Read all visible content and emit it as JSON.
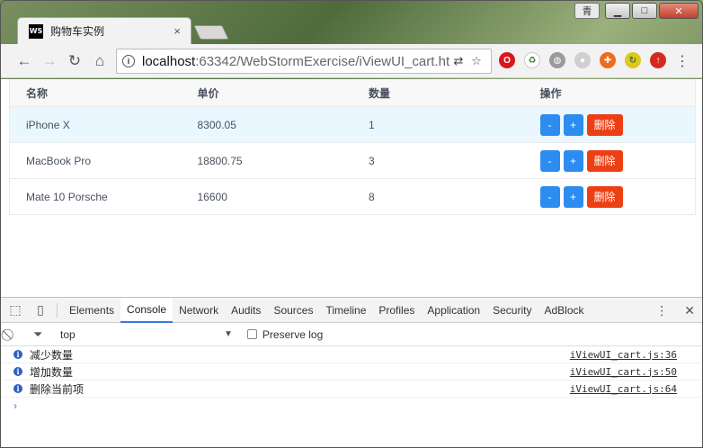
{
  "browser": {
    "tab_title": "购物车实例",
    "favicon_text": "WS",
    "tab_close": "×",
    "profile_label": "青",
    "win_minimize": "▁",
    "win_maximize": "□",
    "win_close": "✕",
    "url_host": "localhost",
    "url_path": ":63342/WebStormExercise/iViewUI_cart.ht"
  },
  "table": {
    "headers": [
      "名称",
      "单价",
      "数量",
      "操作"
    ],
    "rows": [
      {
        "name": "iPhone X",
        "price": "8300.05",
        "qty": "1"
      },
      {
        "name": "MacBook Pro",
        "price": "18800.75",
        "qty": "3"
      },
      {
        "name": "Mate 10 Porsche",
        "price": "16600",
        "qty": "8"
      }
    ],
    "btn_minus": "-",
    "btn_plus": "+",
    "btn_delete": "删除",
    "colors": {
      "primary": "#2d8cf0",
      "error": "#ed3f14",
      "highlight": "#ebf7ff"
    }
  },
  "devtools": {
    "tabs": [
      "Elements",
      "Console",
      "Network",
      "Audits",
      "Sources",
      "Timeline",
      "Profiles",
      "Application",
      "Security",
      "AdBlock"
    ],
    "active_tab": "Console",
    "context": "top",
    "preserve_log": "Preserve log",
    "logs": [
      {
        "msg": "减少数量",
        "src": "iViewUI_cart.js:36"
      },
      {
        "msg": "增加数量",
        "src": "iViewUI_cart.js:50"
      },
      {
        "msg": "删除当前项",
        "src": "iViewUI_cart.js:64"
      }
    ],
    "prompt": "›"
  }
}
